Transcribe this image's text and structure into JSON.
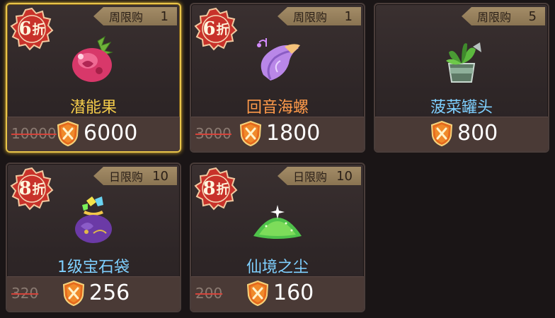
{
  "cards": [
    {
      "discount_num": "6",
      "discount_unit": "折",
      "limit_label": "周限购",
      "limit_count": "1",
      "name": "潜能果",
      "name_color": "gold",
      "old_price": "10000",
      "price": "6000",
      "icon": "potential-fruit-icon",
      "selected": true
    },
    {
      "discount_num": "6",
      "discount_unit": "折",
      "limit_label": "周限购",
      "limit_count": "1",
      "name": "回音海螺",
      "name_color": "orange",
      "old_price": "3000",
      "price": "1800",
      "icon": "echo-conch-icon",
      "selected": false
    },
    {
      "discount_num": "",
      "discount_unit": "",
      "limit_label": "周限购",
      "limit_count": "5",
      "name": "菠菜罐头",
      "name_color": "blue",
      "old_price": "",
      "price": "800",
      "icon": "spinach-can-icon",
      "selected": false
    },
    {
      "discount_num": "8",
      "discount_unit": "折",
      "limit_label": "日限购",
      "limit_count": "10",
      "name": "1级宝石袋",
      "name_color": "blue",
      "old_price": "320",
      "price": "256",
      "icon": "gem-bag-icon",
      "selected": false
    },
    {
      "discount_num": "8",
      "discount_unit": "折",
      "limit_label": "日限购",
      "limit_count": "10",
      "name": "仙境之尘",
      "name_color": "blue",
      "old_price": "200",
      "price": "160",
      "icon": "fairy-dust-icon",
      "selected": false
    }
  ],
  "colors": {
    "selected_border": "#e8c44a",
    "badge_red": "#c8322a",
    "gold_name": "#f4cc4a",
    "orange_name": "#ff9a4a",
    "blue_name": "#7fd0ff",
    "strike": "#d4433a"
  },
  "currency_icon": "shield-coin-icon"
}
